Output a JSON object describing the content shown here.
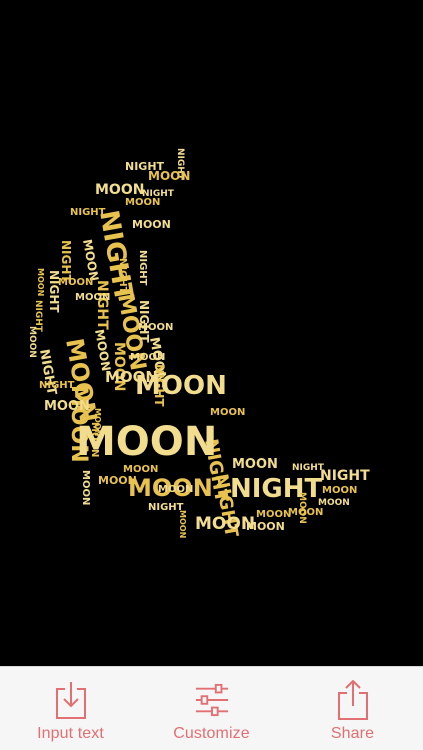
{
  "cloud": {
    "words": [
      {
        "text": "NIGHT",
        "color": "#f2dd8e"
      },
      {
        "text": "MOON",
        "color": "#e8c24f"
      }
    ]
  },
  "toolbar": {
    "input_label": "Input text",
    "customize_label": "Customize",
    "share_label": "Share",
    "accent": "#e26f72"
  }
}
